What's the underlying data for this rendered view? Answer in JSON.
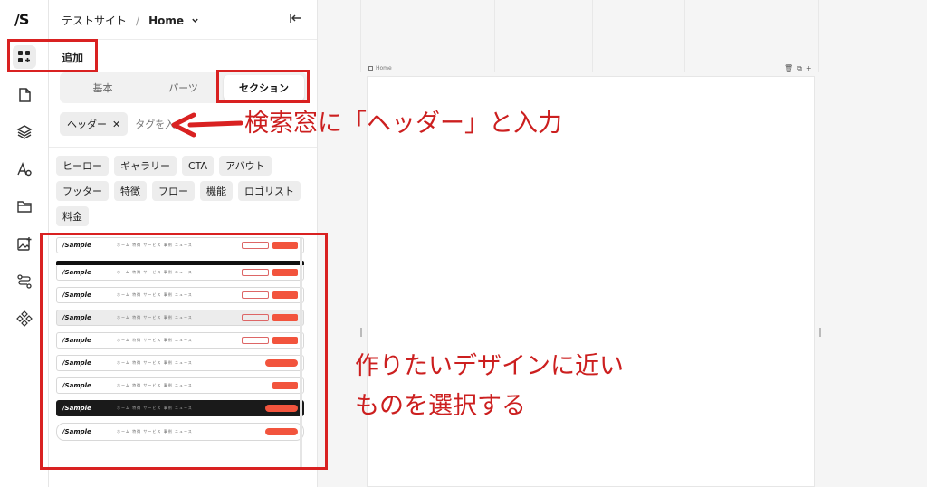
{
  "app": {
    "logo": "/S",
    "site_name": "テストサイト",
    "separator": "/",
    "page_name": "Home"
  },
  "rail": {
    "items": [
      {
        "name": "add-icon",
        "active": true
      },
      {
        "name": "page-icon",
        "active": false
      },
      {
        "name": "layers-icon",
        "active": false
      },
      {
        "name": "typography-icon",
        "active": false
      },
      {
        "name": "folder-icon",
        "active": false
      },
      {
        "name": "image-add-icon",
        "active": false
      },
      {
        "name": "flow-icon",
        "active": false
      },
      {
        "name": "components-icon",
        "active": false
      }
    ]
  },
  "panel": {
    "title": "追加",
    "tabs": [
      {
        "label": "基本",
        "selected": false
      },
      {
        "label": "パーツ",
        "selected": false
      },
      {
        "label": "セクション",
        "selected": true
      }
    ],
    "search": {
      "active_tag": "ヘッダー",
      "remove_glyph": "✕",
      "placeholder": "タグを入"
    },
    "tags": [
      "ヒーロー",
      "ギャラリー",
      "CTA",
      "アバウト",
      "フッター",
      "特徴",
      "フロー",
      "機能",
      "ロゴリスト",
      "料金"
    ],
    "thumbnails": [
      {
        "brand": "Sample",
        "nav": "ホーム 特徴 サービス 事例 ニュース",
        "style": "plain",
        "ghost": true
      },
      {
        "brand": "Sample",
        "nav": "ホーム 特徴 サービス 事例 ニュース",
        "style": "topbar",
        "ghost": true
      },
      {
        "brand": "Sample",
        "nav": "ホーム 特徴 サービス 事例 ニュース",
        "style": "plain",
        "ghost": true
      },
      {
        "brand": "Sample",
        "nav": "ホーム 特徴 サービス 事例 ニュース",
        "style": "gray",
        "ghost": true
      },
      {
        "brand": "Sample",
        "nav": "ホーム 特徴 サービス 事例 ニュース",
        "style": "plain",
        "ghost": true
      },
      {
        "brand": "Sample",
        "nav": "ホーム 特徴 サービス 事例 ニュース",
        "style": "pill",
        "ghost": false
      },
      {
        "brand": "Sample",
        "nav": "ホーム 特徴 サービス 事例 ニュース",
        "style": "plain",
        "ghost": false
      },
      {
        "brand": "Sample",
        "nav": "ホーム 特徴 サービス 事例 ニュース",
        "style": "dark",
        "ghost": false
      },
      {
        "brand": "Sample",
        "nav": "ホーム 特徴 サービス 事例 ニュース",
        "style": "round",
        "ghost": false
      }
    ]
  },
  "annotations": {
    "search_note": "検索窓に「ヘッダー」と入力",
    "select_note_line1": "作りたいデザインに近い",
    "select_note_line2": "ものを選択する",
    "color": "#d92121"
  },
  "canvas": {
    "frame_label": "Home"
  }
}
